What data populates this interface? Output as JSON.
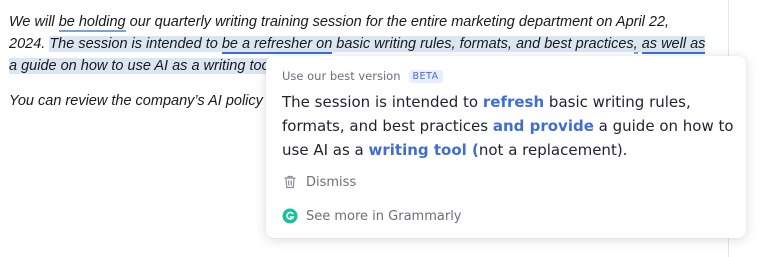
{
  "document": {
    "p1": {
      "t1": "We will ",
      "t2": "be holding",
      "t3": " our quarterly writing training session for the entire marketing department on April 22, 2024. ",
      "s1": "The session is intended to ",
      "s2": "be a refresher on",
      "s3": " basic writing rules, formats, and best practices",
      "s4": ",",
      "s5": " ",
      "s6": "as well as",
      "s7": " a guide on how to use AI as a writing tool (not a replacement)."
    },
    "p2": "You can review the company’s AI policy and find the list of approved AI tools available to use."
  },
  "popup": {
    "header": "Use our best version",
    "badge": "BETA",
    "suggestion": {
      "a": "The session is intended to ",
      "b": "refresh",
      "c": " basic writing rules, formats, and best practices ",
      "d": "and provide",
      "e": " a guide on how to use AI as a ",
      "f": "writing tool (",
      "g": "not a replacement)."
    },
    "dismiss_label": "Dismiss",
    "see_more_label": "See more in Grammarly",
    "icons": {
      "dismiss": "trash-icon",
      "see_more": "grammarly-logo-icon"
    },
    "colors": {
      "accent": "#3f6ed1",
      "grammarly_green": "#15c39a"
    }
  }
}
